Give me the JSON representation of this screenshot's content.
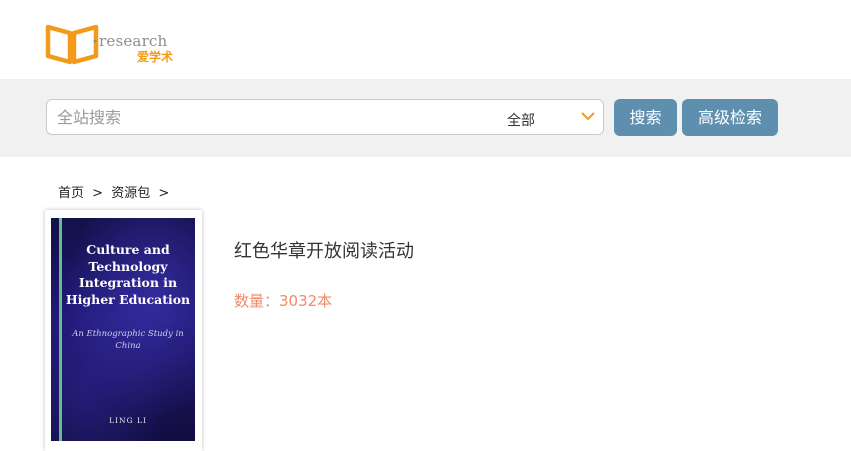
{
  "brand": {
    "logo_text": "research",
    "logo_cn": "爱学术",
    "accent_color": "#f29a1a"
  },
  "search": {
    "placeholder": "全站搜索",
    "scope_selected": "全部",
    "search_button": "搜索",
    "advanced_button": "高级检索",
    "button_color": "#5f8fae"
  },
  "breadcrumb": {
    "home": "首页",
    "separator": ">",
    "current": "资源包"
  },
  "package": {
    "title": "红色华章开放阅读活动",
    "count_label": "数量：3032本",
    "count_color": "#ef8a6a"
  },
  "cover": {
    "title": "Culture and Technology Integration in Higher Education",
    "subtitle": "An Ethnographic Study in China",
    "author": "LING LI"
  }
}
